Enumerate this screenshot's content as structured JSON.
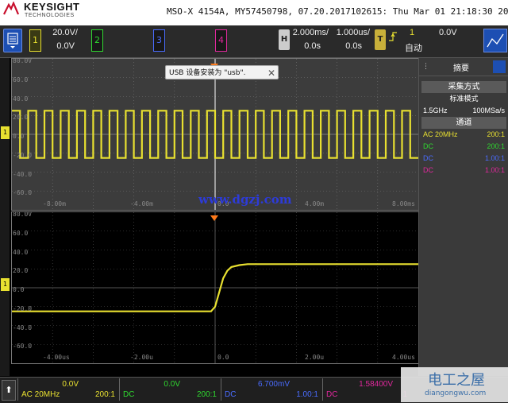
{
  "header": {
    "brand": "KEYSIGHT",
    "brand_sub": "TECHNOLOGIES",
    "instrument": "MSO-X 4154A, MY57450798, 07.20.2017102615: Thu Mar 01 21:18:30 2018"
  },
  "toolbar": {
    "ch1_label": "1",
    "ch1_scale": "20.0V/",
    "ch1_offset": "0.0V",
    "ch2_label": "2",
    "ch3_label": "3",
    "ch4_label": "4",
    "h_label": "H",
    "time_scale": "2.000ms/",
    "time_delay": "0.0s",
    "zoom_scale": "1.000us/",
    "zoom_delay": "0.0s",
    "t_label": "T",
    "trig_source": "1",
    "trig_level": "0.0V",
    "trig_mode": "自动"
  },
  "toast": {
    "text": "USB 设备安装为 \"usb\".",
    "close": "✕"
  },
  "watermark": "www.dgzj.com",
  "upper_grid": {
    "y_labels": [
      "80.0V",
      "60.0",
      "40.0",
      "20.0",
      "0.0",
      "-20.0",
      "-40.0",
      "-60.0"
    ],
    "x_labels": [
      "-8.00m",
      "-4.00m",
      "0.0",
      "4.00m",
      "8.00ms"
    ]
  },
  "lower_grid": {
    "y_labels": [
      "80.0V",
      "60.0",
      "40.0",
      "20.0",
      "0.0",
      "-20.0",
      "-40.0",
      "-60.0"
    ],
    "x_labels": [
      "-4.00us",
      "-2.00u",
      "0.0",
      "2.00u",
      "4.00us"
    ]
  },
  "right_panel": {
    "title": "摘要",
    "acq_head": "采集方式",
    "acq_mode": "标准模式",
    "sample_bw": "1.5GHz",
    "sample_rate": "100MSa/s",
    "ch_head": "通道",
    "channels": [
      {
        "coupling": "AC  20MHz",
        "probe": "200:1",
        "color": "#e8e030"
      },
      {
        "coupling": "DC",
        "probe": "200:1",
        "color": "#2fd82f"
      },
      {
        "coupling": "DC",
        "probe": "1.00:1",
        "color": "#4a6cff"
      },
      {
        "coupling": "DC",
        "probe": "1.00:1",
        "color": "#e0289c"
      }
    ]
  },
  "bottom": {
    "ch1": {
      "value": "0.0V",
      "coupling": "AC 20MHz",
      "atten": "200:1"
    },
    "ch2": {
      "value": "0.0V",
      "coupling": "DC",
      "atten": "200:1"
    },
    "ch3": {
      "value": "6.700mV",
      "coupling": "DC",
      "atten": "1.00:1"
    },
    "ch4": {
      "value": "1.58400V",
      "coupling": "DC",
      "atten": "1"
    }
  },
  "site_badge": {
    "title": "电工之屋",
    "url": "diangongwu.com"
  },
  "colors": {
    "ch1": "#e8e030",
    "ch2": "#2fd82f",
    "ch3": "#4a6cff",
    "ch4": "#e0289c"
  },
  "chart_data": [
    {
      "type": "line",
      "series": [
        {
          "x": [
            -10,
            -9.6,
            -9.6,
            -9.2,
            -9.2,
            -8.8,
            -8.8,
            -8.4,
            -8.4,
            -8.0,
            -8.0,
            -7.6,
            -7.6,
            -7.2,
            -7.2,
            -6.8,
            -6.8,
            -6.4,
            -6.4,
            -6.0,
            -6.0,
            -5.6,
            -5.6,
            -5.2,
            -5.2,
            -4.8,
            -4.8,
            -4.4,
            -4.4,
            -4.0,
            -4.0,
            -3.6,
            -3.6,
            -3.2,
            -3.2,
            -2.8,
            -2.8,
            -2.4,
            -2.4,
            -2.0,
            -2.0,
            -1.6,
            -1.6,
            -1.2,
            -1.2,
            -0.8,
            -0.8,
            -0.4,
            -0.4,
            0.0,
            0.0,
            0.4,
            0.4,
            0.8,
            0.8,
            1.2,
            1.2,
            1.6,
            1.6,
            2.0,
            2.0,
            2.4,
            2.4,
            2.8,
            2.8,
            3.2,
            3.2,
            3.6,
            3.6,
            4.0,
            4.0,
            4.4,
            4.4,
            4.8,
            4.8,
            5.2,
            5.2,
            5.6,
            5.6,
            6.0,
            6.0,
            6.4,
            6.4,
            6.8,
            6.8,
            7.2,
            7.2,
            7.6,
            7.6,
            8.0,
            8.0,
            8.4,
            8.4,
            8.8,
            8.8,
            9.2,
            9.2,
            9.6,
            9.6,
            10
          ],
          "y": [
            25,
            25,
            -25,
            -25,
            25,
            25,
            -25,
            -25,
            25,
            25,
            -25,
            -25,
            25,
            25,
            -25,
            -25,
            25,
            25,
            -25,
            -25,
            25,
            25,
            -25,
            -25,
            25,
            25,
            -25,
            -25,
            25,
            25,
            -25,
            -25,
            25,
            25,
            -25,
            -25,
            25,
            25,
            -25,
            -25,
            25,
            25,
            -25,
            -25,
            25,
            25,
            -25,
            -25,
            25,
            25,
            -25,
            -25,
            25,
            25,
            -25,
            -25,
            25,
            25,
            -25,
            -25,
            25,
            25,
            -25,
            -25,
            25,
            25,
            -25,
            -25,
            25,
            25,
            -25,
            -25,
            25,
            25,
            -25,
            -25,
            25,
            25,
            -25,
            -25,
            25,
            25,
            -25,
            -25,
            25,
            25,
            -25,
            -25,
            25,
            25,
            -25,
            -25,
            25,
            25,
            -25,
            -25,
            25,
            25,
            -25,
            -25
          ]
        }
      ],
      "xlim": [
        -10,
        10
      ],
      "ylim": [
        -80,
        80
      ],
      "grid": true
    },
    {
      "type": "line",
      "series": [
        {
          "x": [
            -5.0,
            -0.1,
            0.0,
            0.1,
            0.2,
            0.3,
            0.4,
            0.6,
            0.8,
            1.0,
            5.0
          ],
          "y": [
            -25,
            -25,
            -20,
            -5,
            10,
            18,
            22,
            24,
            25,
            25,
            25
          ]
        }
      ],
      "xlim": [
        -5,
        5
      ],
      "ylim": [
        -80,
        80
      ],
      "grid": true
    }
  ]
}
